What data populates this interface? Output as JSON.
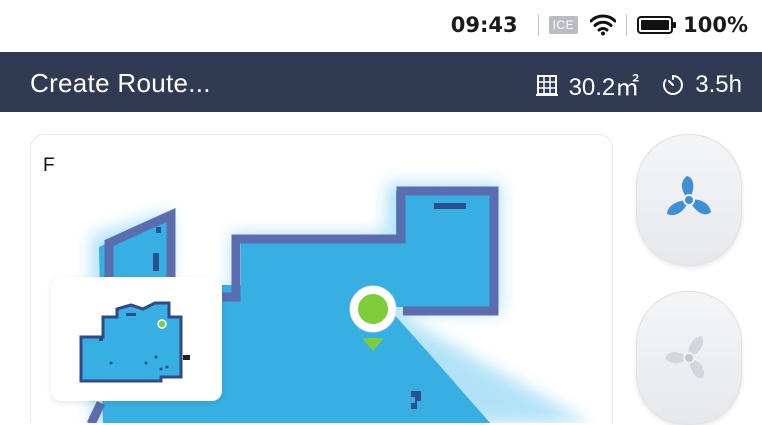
{
  "status_bar": {
    "time": "09:43",
    "sim_label": "ICE",
    "battery": "100%",
    "icons": [
      "wifi-icon",
      "battery-icon"
    ]
  },
  "header": {
    "title": "Create Route...",
    "area": "30.2㎡",
    "duration": "3.5h",
    "icons": [
      "area-icon",
      "timer-icon"
    ]
  },
  "map": {
    "floor": "F",
    "colors": {
      "floor_fill": "#37afe3",
      "wall": "#5b6dae",
      "glow": "#9bd8f3",
      "marker": "#7fcc3a"
    }
  },
  "controls": {
    "fan_buttons": [
      {
        "icon": "fan-icon",
        "color": "#3d8fd6",
        "state": "active"
      },
      {
        "icon": "fan-icon",
        "color": "#cfd2d8",
        "state": "inactive"
      }
    ]
  },
  "colors": {
    "header_bg": "#303a52",
    "accent": "#37afe3"
  }
}
